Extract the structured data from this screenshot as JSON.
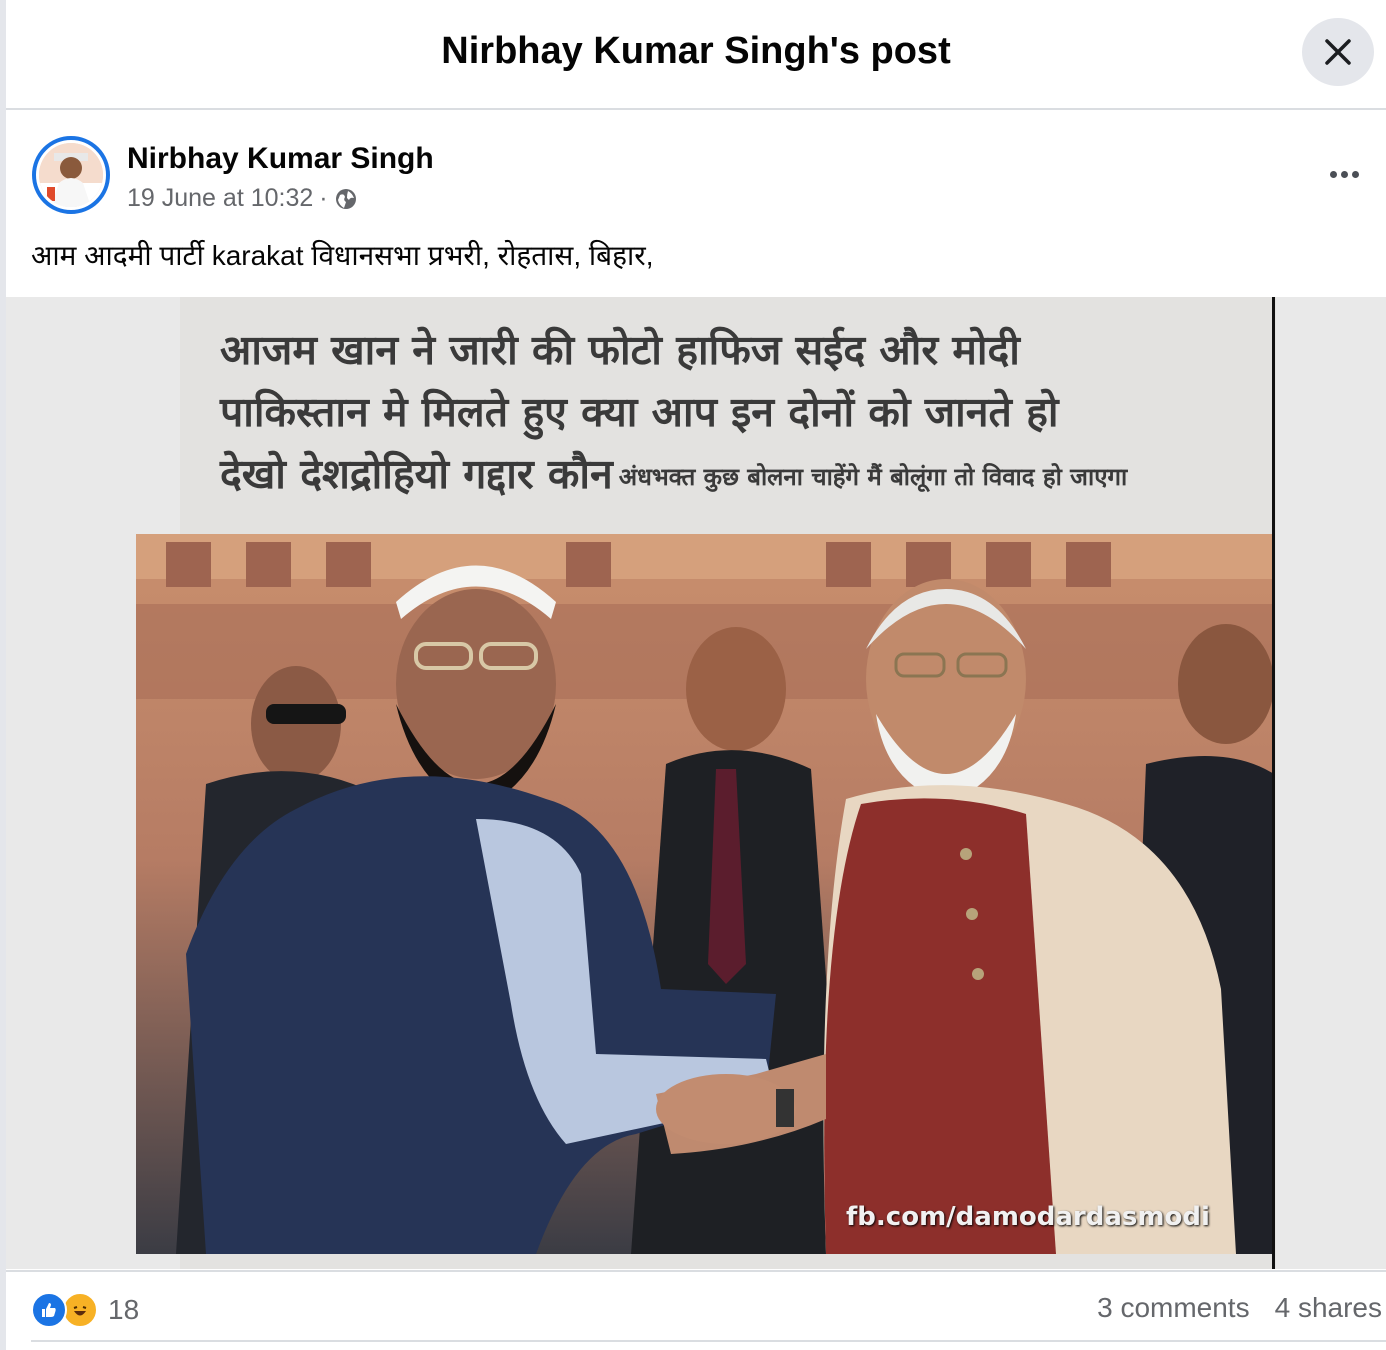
{
  "modal": {
    "title": "Nirbhay Kumar Singh's post"
  },
  "post": {
    "author": "Nirbhay Kumar Singh",
    "timestamp": "19 June at 10:32",
    "separator": "·",
    "visibility_icon": "globe-icon",
    "text": "आम आदमी पार्टी karakat विधानसभा प्रभरी, रोहतास, बिहार,"
  },
  "image": {
    "headline_line1": "आजम खान ने जारी की फोटो हाफिज सईद और मोदी",
    "headline_line2": "पाकिस्तान मे मिलते हुए  क्या आप इन दोनों को जानते हो",
    "headline_line3": "देखो देशद्रोहियो गद्दार कौन",
    "headline_small": "अंधभक्त कुछ बोलना चाहेंगे मैं बोलूंगा तो विवाद हो जाएगा",
    "watermark": "fb.com/damodardasmodi"
  },
  "footer": {
    "reaction_count": "18",
    "comments": "3 comments",
    "shares": "4 shares"
  },
  "colors": {
    "accent": "#1b74e4",
    "haha": "#f7b125",
    "muted": "#65676b"
  }
}
